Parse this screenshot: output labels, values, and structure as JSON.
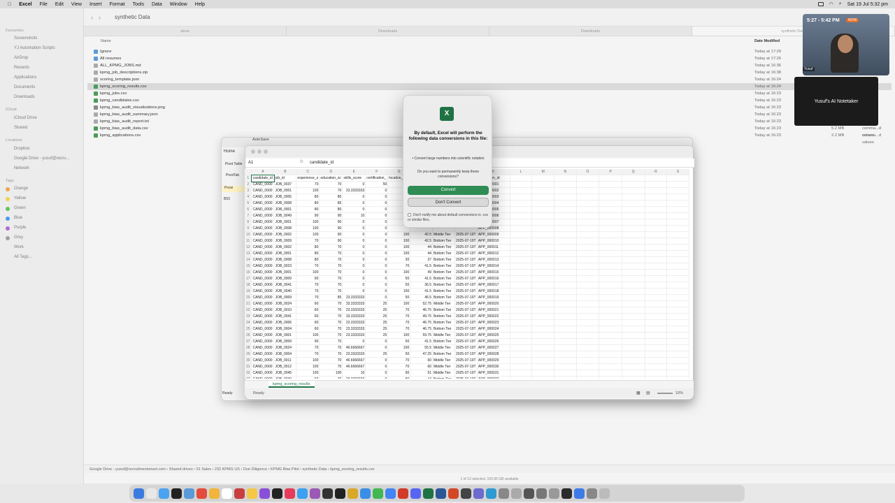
{
  "menubar": {
    "items": [
      "Excel",
      "File",
      "Edit",
      "View",
      "Insert",
      "Format",
      "Tools",
      "Data",
      "Window",
      "Help"
    ],
    "datetime": "Sat 19 Jul  5:32 pm"
  },
  "finder": {
    "title": "synthetic Data",
    "tabs": [
      "slove",
      "Downloads",
      "Downloads",
      "synthetic Data"
    ],
    "col_name": "Name",
    "col_date": "Date Modified",
    "sidebar": {
      "favourites_label": "Favourites",
      "favourites": [
        "Screenshots",
        "YJ Automation Scripts",
        "AirDrop",
        "Recents",
        "Applications",
        "Documents",
        "Downloads"
      ],
      "icloud_label": "iCloud",
      "icloud": [
        "iCloud Drive",
        "Shared"
      ],
      "locations_label": "Locations",
      "locations": [
        "Dropbox",
        "Google Drive - yusuf@recru...",
        "Network"
      ],
      "tags_label": "Tags",
      "tags": [
        "Orange",
        "Yellow",
        "Green",
        "Blue",
        "Purple",
        "Grey",
        "Work",
        "All Tags..."
      ],
      "tag_colors": [
        "#f0a64a",
        "#f2d34a",
        "#63c45c",
        "#4a9af0",
        "#b06ad0",
        "#a0a0a0"
      ]
    },
    "files": [
      {
        "name": "Ignore",
        "date": "Today at 17:29",
        "size": "",
        "kind": ""
      },
      {
        "name": "All resumes",
        "date": "Today at 17:26",
        "size": "",
        "kind": ""
      },
      {
        "name": "ALL_KPMG_JOBS.md",
        "date": "Today at 16:36",
        "size": "",
        "kind": ""
      },
      {
        "name": "kpmg_job_descriptions.zip",
        "date": "Today at 16:38",
        "size": "",
        "kind": ""
      },
      {
        "name": "scoring_template.json",
        "date": "Today at 16:24",
        "size": "",
        "kind": ""
      },
      {
        "name": "kpmg_scoring_results.csv",
        "date": "Today at 16:24",
        "size": "",
        "kind": "values"
      },
      {
        "name": "kpmg_jobs.csv",
        "date": "Today at 16:23",
        "size": "",
        "kind": "values"
      },
      {
        "name": "kpmg_candidates.csv",
        "date": "Today at 16:23",
        "size": "",
        "kind": "values"
      },
      {
        "name": "kpmg_bias_audit_visualizations.png",
        "date": "Today at 16:23",
        "size": "",
        "kind": ""
      },
      {
        "name": "kpmg_bias_audit_summary.json",
        "date": "Today at 16:23",
        "size": "",
        "kind": ""
      },
      {
        "name": "kpmg_bias_audit_report.txt",
        "date": "Today at 16:23",
        "size": "",
        "kind": ""
      },
      {
        "name": "kpmg_bias_audit_data.csv",
        "date": "Today at 16:23",
        "size": "5.2 MB",
        "kind": "comma...d values"
      },
      {
        "name": "kpmg_applications.csv",
        "date": "Today at 16:23",
        "size": "2.2 MB",
        "kind": "comma...d values"
      }
    ],
    "path": "Google Drive - yusuf@recruitmentsmart.com  ›  Shared drives  ›  01 Sales  ›  232 KPMG US  ›  Due Diligence  ›  KPMG Bias Pilot  ›  synthetic Data  ›  kpmg_scoring_results.csv",
    "status": "1 of 13 selected, 100.96 GB available"
  },
  "excel": {
    "autosave": "AutoSave",
    "ribbon_home": "Home",
    "pivot_table": "Pivot Table",
    "pivot_tab": "PivotTab",
    "possible": "Possi",
    "left_cell": "B53",
    "name_box": "A1",
    "formula": "candidate_id",
    "fx": "fx",
    "cols": [
      "A",
      "B",
      "C",
      "D",
      "E",
      "F",
      "G",
      "H",
      "I",
      "J",
      "K",
      "L",
      "M",
      "N",
      "O",
      "P",
      "Q",
      "R",
      "S"
    ],
    "headers": [
      "candidate_id",
      "job_id",
      "experience_s",
      "education_sc",
      "skills_score",
      "certification_",
      "location_sco",
      "",
      "",
      "",
      "application_id"
    ],
    "rows": [
      [
        "CAND_0000",
        "JOB_0037",
        "70",
        "70",
        "0",
        "50",
        "",
        "",
        "",
        "",
        "APP_000001"
      ],
      [
        "CAND_0000",
        "JOB_0001",
        "100",
        "70",
        "23.3333333",
        "0",
        "",
        "",
        "",
        "",
        "APP_000002"
      ],
      [
        "CAND_0000",
        "JOB_0005",
        "80",
        "85",
        "0",
        "0",
        "",
        "",
        "",
        "",
        "APP_000003"
      ],
      [
        "CAND_0000",
        "JOB_0008",
        "80",
        "85",
        "0",
        "0",
        "",
        "",
        "",
        "",
        "APP_000004"
      ],
      [
        "CAND_0000",
        "JOB_0001",
        "80",
        "85",
        "0",
        "0",
        "",
        "",
        "",
        "",
        "APP_000005"
      ],
      [
        "CAND_0000",
        "JOB_0049",
        "90",
        "90",
        "10",
        "0",
        "",
        "",
        "",
        "",
        "APP_000006"
      ],
      [
        "CAND_0000",
        "JOB_0001",
        "100",
        "90",
        "0",
        "0",
        "",
        "",
        "",
        "",
        "APP_000007"
      ],
      [
        "CAND_0000",
        "JOB_0008",
        "100",
        "90",
        "0",
        "0",
        "",
        "",
        "",
        "",
        "APP_000008"
      ],
      [
        "CAND_0000",
        "JOB_0002",
        "100",
        "90",
        "0",
        "0",
        "100",
        "42.5",
        "Middle Tier",
        "2025-07-19T",
        "APP_000009"
      ],
      [
        "CAND_0000",
        "JOB_0009",
        "70",
        "90",
        "0",
        "0",
        "100",
        "42.5",
        "Bottom Tier",
        "2025-07-19T",
        "APP_000010"
      ],
      [
        "CAND_0000",
        "JOB_0002",
        "80",
        "70",
        "0",
        "0",
        "100",
        "44",
        "Bottom Tier",
        "2025-07-19T",
        "APP_000011"
      ],
      [
        "CAND_0000",
        "JOB_0001",
        "80",
        "70",
        "0",
        "0",
        "100",
        "44",
        "Bottom Tier",
        "2025-07-19T",
        "APP_000012"
      ],
      [
        "CAND_0000",
        "JOB_0008",
        "80",
        "70",
        "0",
        "0",
        "30",
        "37",
        "Bottom Tier",
        "2025-07-19T",
        "APP_000013"
      ],
      [
        "CAND_0000",
        "JOB_0023",
        "70",
        "70",
        "0",
        "0",
        "70",
        "41.5",
        "Bottom Tier",
        "2025-07-19T",
        "APP_000014"
      ],
      [
        "CAND_0000",
        "JOB_0001",
        "100",
        "70",
        "0",
        "0",
        "100",
        "49",
        "Bottom Tier",
        "2025-07-19T",
        "APP_000015"
      ],
      [
        "CAND_0000",
        "JOB_0009",
        "90",
        "70",
        "0",
        "0",
        "50",
        "41.5",
        "Bottom Tier",
        "2025-07-19T",
        "APP_000016"
      ],
      [
        "CAND_0000",
        "JOB_0041",
        "70",
        "70",
        "0",
        "0",
        "50",
        "36.5",
        "Bottom Tier",
        "2025-07-19T",
        "APP_000017"
      ],
      [
        "CAND_0000",
        "JOB_0040",
        "70",
        "70",
        "0",
        "0",
        "100",
        "41.5",
        "Bottom Tier",
        "2025-07-19T",
        "APP_000018"
      ],
      [
        "CAND_0000",
        "JOB_0009",
        "70",
        "85",
        "23.3333333",
        "0",
        "50",
        "46.5",
        "Bottom Tier",
        "2025-07-19T",
        "APP_000019"
      ],
      [
        "CAND_0000",
        "JOB_0024",
        "60",
        "70",
        "33.3333333",
        "25",
        "100",
        "52.75",
        "Middle Tier",
        "2025-07-19T",
        "APP_000020"
      ],
      [
        "CAND_0000",
        "JOB_0010",
        "60",
        "70",
        "23.3333333",
        "25",
        "70",
        "46.75",
        "Bottom Tier",
        "2025-07-19T",
        "APP_000021"
      ],
      [
        "CAND_0000",
        "JOB_0041",
        "60",
        "70",
        "33.3333333",
        "25",
        "70",
        "49.75",
        "Bottom Tier",
        "2025-07-19T",
        "APP_000022"
      ],
      [
        "CAND_0000",
        "JOB_0006",
        "60",
        "70",
        "23.3333333",
        "25",
        "70",
        "46.75",
        "Bottom Tier",
        "2025-07-19T",
        "APP_000023"
      ],
      [
        "CAND_0000",
        "JOB_0004",
        "60",
        "70",
        "23.3333333",
        "25",
        "70",
        "46.75",
        "Bottom Tier",
        "2025-07-19T",
        "APP_000024"
      ],
      [
        "CAND_0000",
        "JOB_0001",
        "100",
        "70",
        "23.3333333",
        "25",
        "100",
        "59.75",
        "Middle Tier",
        "2025-07-19T",
        "APP_000025"
      ],
      [
        "CAND_0000",
        "JOB_0009",
        "90",
        "70",
        "0",
        "0",
        "50",
        "41.5",
        "Bottom Tier",
        "2025-07-19T",
        "APP_000026"
      ],
      [
        "CAND_0000",
        "JOB_0024",
        "70",
        "70",
        "46.6666667",
        "0",
        "100",
        "55.5",
        "Middle Tier",
        "2025-07-19T",
        "APP_000027"
      ],
      [
        "CAND_0000",
        "JOB_0004",
        "70",
        "70",
        "23.3333333",
        "25",
        "50",
        "47.25",
        "Bottom Tier",
        "2025-07-19T",
        "APP_000028"
      ],
      [
        "CAND_0000",
        "JOB_0011",
        "100",
        "70",
        "46.6666667",
        "0",
        "70",
        "60",
        "Middle Tier",
        "2025-07-19T",
        "APP_000029"
      ],
      [
        "CAND_0000",
        "JOB_0012",
        "100",
        "70",
        "46.6666667",
        "0",
        "70",
        "60",
        "Middle Tier",
        "2025-07-19T",
        "APP_000030"
      ],
      [
        "CAND_0000",
        "JOB_0045",
        "100",
        "100",
        "10",
        "0",
        "90",
        "51",
        "Middle Tier",
        "2025-07-19T",
        "APP_000031"
      ],
      [
        "CAND_0000",
        "JOB_0030",
        "60",
        "70",
        "23.3333333",
        "0",
        "80",
        "44",
        "Bottom Tier",
        "2025-07-19T",
        "APP_000032"
      ],
      [
        "CAND_0000",
        "JOB_0050",
        "60",
        "70",
        "0",
        "0",
        "70",
        "36",
        "Bottom Tier",
        "2025-07-19T",
        "APP_000033"
      ],
      [
        "CAND_0000",
        "JOB_0024",
        "90",
        "70",
        "10",
        "0",
        "100",
        "49.5",
        "Bottom Tier",
        "2025-07-19T",
        "APP_000034"
      ],
      [
        "CAND_0000",
        "JOB_0021",
        "90",
        "70",
        "0",
        "0",
        "70",
        "43.5",
        "Bottom Tier",
        "2025-07-19T",
        "APP_000035"
      ]
    ],
    "sheet_tab": "kpmg_scoring_results",
    "ready": "Ready",
    "left_ready": "Ready",
    "zoom": "10%"
  },
  "dialog": {
    "app_letter": "X",
    "title": "By default, Excel will perform the following data conversions in this file:",
    "bullet": "• Convert large numbers into scientific notation",
    "question": "Do you want to permanently keep these conversions?",
    "convert_label": "Convert",
    "dont_convert_label": "Don't Convert",
    "notify_label": "Don't notify me about default conversions in .csv or similar files."
  },
  "video": {
    "time": "5:27 - 5:42 PM",
    "now": "NOW",
    "label": "Yusuf"
  },
  "notetaker": {
    "text": "Yusuf's AI Notetaker"
  },
  "dock_colors": [
    "#3b7be0",
    "#e8e8e8",
    "#4aa3f0",
    "#222",
    "#5a9ad8",
    "#e34b3b",
    "#f0b53a",
    "#fff",
    "#c93f3f",
    "#f6c744",
    "#8a4fd8",
    "#222",
    "#e63b5a",
    "#3aa0f0",
    "#9b59b6",
    "#333",
    "#222",
    "#d8a82a",
    "#3a8ee6",
    "#41b851",
    "#4285f4",
    "#d23a2a",
    "#5865f2",
    "#1f7244",
    "#2b5797",
    "#d24726",
    "#444",
    "#6b6bd0",
    "#2e9ad0",
    "#888",
    "#aaa",
    "#555",
    "#777",
    "#999",
    "#2b2b2b",
    "#3d7be8",
    "#888",
    "#bbb"
  ]
}
